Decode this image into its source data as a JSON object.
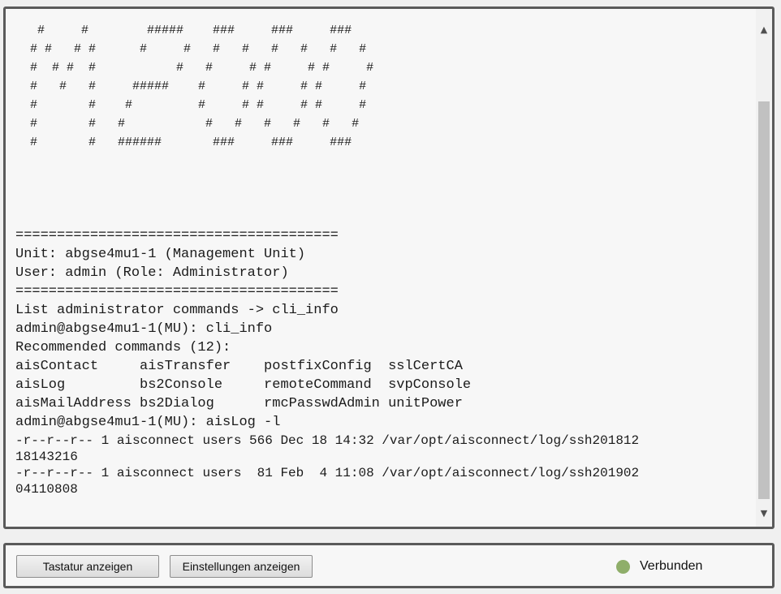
{
  "terminal": {
    "banner": [
      "   #     #        #####    ###     ###     ###",
      "  # #   # #      #     #   #   #   #   #   #   #",
      "  #  # #  #           #   #     # #     # #     #",
      "  #   #   #     #####    #     # #     # #     #",
      "  #       #    #         #     # #     # #     #",
      "  #       #   #           #   #   #   #   #   #",
      "  #       #   ######       ###     ###     ###"
    ],
    "lines": [
      "=======================================",
      "Unit: abgse4mu1-1 (Management Unit)",
      "User: admin (Role: Administrator)",
      "=======================================",
      "List administrator commands -> cli_info",
      "admin@abgse4mu1-1(MU): cli_info",
      "Recommended commands (12):",
      "aisContact     aisTransfer    postfixConfig  sslCertCA",
      "aisLog         bs2Console     remoteCommand  svpConsole",
      "aisMailAddress bs2Dialog      rmcPasswdAdmin unitPower",
      "admin@abgse4mu1-1(MU): aisLog -l"
    ],
    "listing": [
      "-r--r--r-- 1 aisconnect users 566 Dec 18 14:32 /var/opt/aisconnect/log/ssh201812",
      "18143216",
      "-r--r--r-- 1 aisconnect users  81 Feb  4 11:08 /var/opt/aisconnect/log/ssh201902",
      "04110808"
    ]
  },
  "scrollbar": {
    "up_icon": "chevron-up-icon",
    "down_icon": "chevron-down-icon",
    "up_glyph": "▲",
    "down_glyph": "▼"
  },
  "buttons": {
    "keyboard_label": "Tastatur anzeigen",
    "settings_label": "Einstellungen anzeigen"
  },
  "status": {
    "label": "Verbunden",
    "color": "#8fae6a"
  }
}
